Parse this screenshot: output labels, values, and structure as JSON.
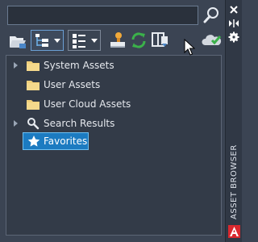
{
  "palette": {
    "background": "#3b4453",
    "tree_background": "#333b48",
    "selection": "#1c7bc1",
    "folder": "#f0cf7a",
    "accent_green": "#3bb14a",
    "logo_red": "#d8282e"
  },
  "search": {
    "value": "",
    "placeholder": "",
    "button_icon": "search-magnifier-icon"
  },
  "toolbar": {
    "items": [
      {
        "name": "open-folder-button",
        "icon": "folder-open-icon"
      },
      {
        "name": "tree-view-dropdown",
        "icon": "tree-view-icon"
      },
      {
        "name": "list-view-dropdown",
        "icon": "list-view-icon"
      },
      {
        "name": "stamp-button",
        "icon": "stamp-icon"
      },
      {
        "name": "refresh-button",
        "icon": "refresh-icon"
      },
      {
        "name": "export-button",
        "icon": "export-icon"
      },
      {
        "name": "cloud-sync-button",
        "icon": "cloud-check-icon"
      }
    ]
  },
  "tree": {
    "nodes": [
      {
        "label": "System Assets",
        "icon": "folder-icon",
        "expandable": true
      },
      {
        "label": "User Assets",
        "icon": "folder-icon",
        "expandable": false
      },
      {
        "label": "User Cloud Assets",
        "icon": "folder-icon",
        "expandable": false
      },
      {
        "label": "Search Results",
        "icon": "search-icon",
        "expandable": true
      },
      {
        "label": "Favorites",
        "icon": "star-icon",
        "expandable": false,
        "selected": true
      }
    ]
  },
  "sidebar": {
    "title": "ASSET BROWSER",
    "controls": [
      "close-icon",
      "auto-hide-icon",
      "settings-icon"
    ],
    "logo_letter": "A"
  }
}
